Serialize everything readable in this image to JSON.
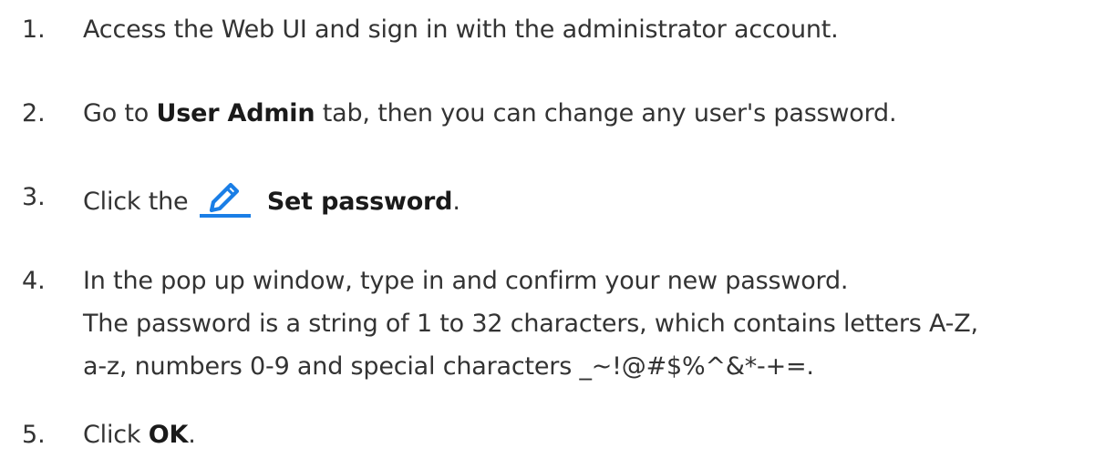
{
  "steps": [
    {
      "number": "1.",
      "text": "Access the Web UI and sign in with the administrator account."
    },
    {
      "number": "2.",
      "prefix": "Go to ",
      "bold": "User Admin",
      "suffix": " tab, then you can change any user's password."
    },
    {
      "number": "3.",
      "prefix": "Click the ",
      "icon": "pencil-edit-icon",
      "bold": "Set password",
      "suffix": "."
    },
    {
      "number": "4.",
      "text": "In the pop up window, type in and confirm your new password.",
      "continuation": [
        "The password is a string of 1 to 32 characters, which contains letters A-Z,",
        "a-z, numbers 0-9 and special characters _~!@#$%^&*-+=."
      ]
    },
    {
      "number": "5.",
      "prefix": "Click ",
      "bold": "OK",
      "suffix": "."
    }
  ],
  "colors": {
    "text": "#333333",
    "accent": "#1a7ee6"
  }
}
